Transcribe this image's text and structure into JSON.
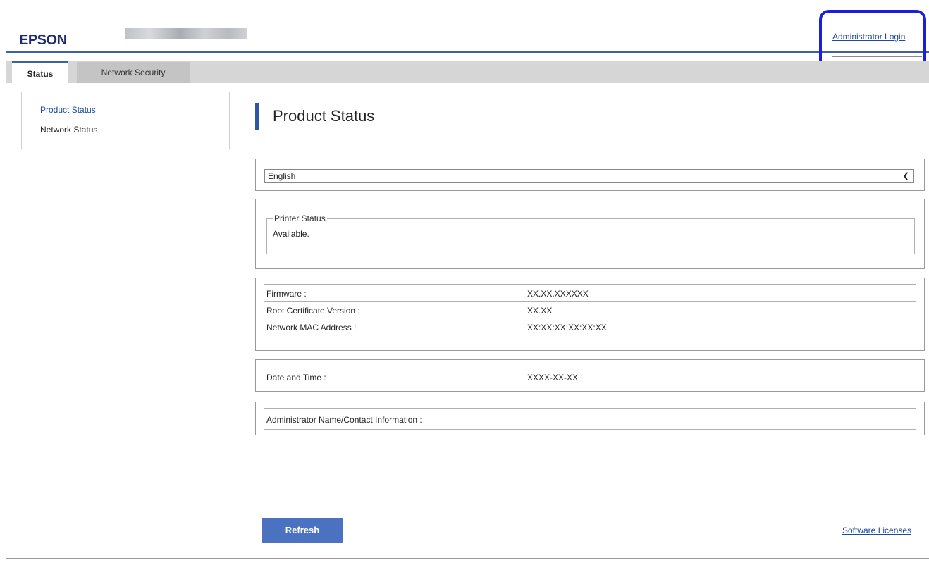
{
  "header": {
    "logo": "EPSON",
    "admin_login": "Administrator Login"
  },
  "tabs": [
    {
      "label": "Status"
    },
    {
      "label": "Network Security"
    }
  ],
  "sidebar": {
    "items": [
      {
        "label": "Product Status"
      },
      {
        "label": "Network Status"
      }
    ]
  },
  "main": {
    "title": "Product Status",
    "language": {
      "selected": "English"
    },
    "printer_status": {
      "legend": "Printer Status",
      "value": "Available."
    },
    "info": [
      {
        "label": "Firmware :",
        "value": "XX.XX.XXXXXX"
      },
      {
        "label": "Root Certificate Version :",
        "value": "XX.XX"
      },
      {
        "label": "Network MAC Address :",
        "value": "XX:XX:XX:XX:XX:XX"
      }
    ],
    "datetime": {
      "label": "Date and Time :",
      "value": "XXXX-XX-XX"
    },
    "admin_contact": {
      "label": "Administrator Name/Contact Information :"
    }
  },
  "footer": {
    "refresh": "Refresh",
    "software_licenses": "Software Licenses"
  },
  "colors": {
    "accent": "#3f5fa8",
    "link": "#1f4a9e",
    "button": "#4a72c0",
    "highlight": "#1a1ee0"
  }
}
